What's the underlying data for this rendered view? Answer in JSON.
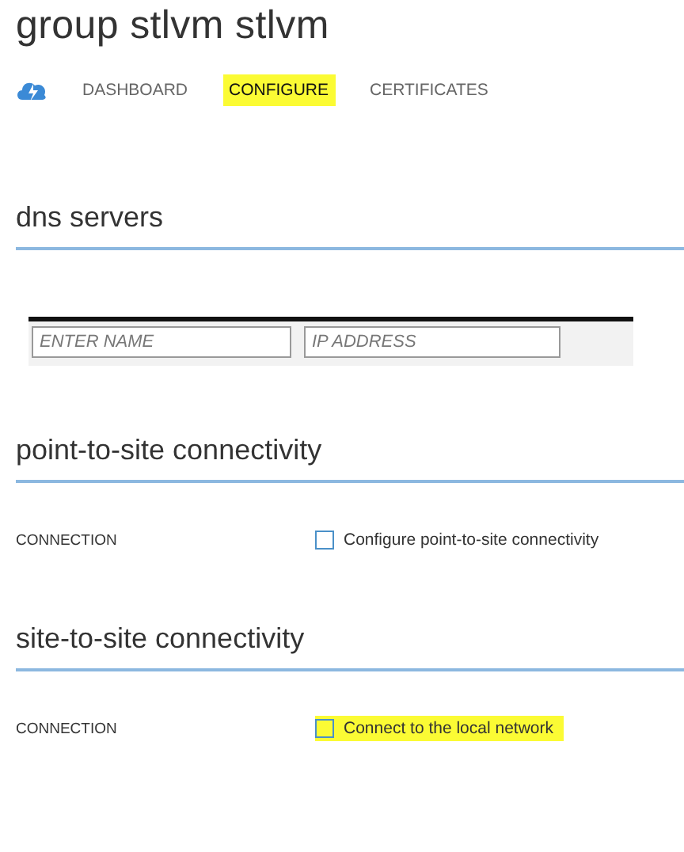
{
  "title": "group stlvm stlvm",
  "tabs": [
    {
      "label": "DASHBOARD",
      "selected": false,
      "highlighted": false
    },
    {
      "label": "CONFIGURE",
      "selected": true,
      "highlighted": true
    },
    {
      "label": "CERTIFICATES",
      "selected": false,
      "highlighted": false
    }
  ],
  "dns_servers": {
    "heading": "dns servers",
    "name_field": {
      "placeholder": "ENTER NAME"
    },
    "ip_field": {
      "placeholder": "IP ADDRESS"
    }
  },
  "sections": [
    {
      "heading": "point-to-site connectivity",
      "label": "CONNECTION",
      "checkbox": {
        "text": "Configure point-to-site connectivity",
        "checked": false,
        "highlighted": false
      }
    },
    {
      "heading": "site-to-site connectivity",
      "label": "CONNECTION",
      "checkbox": {
        "text": "Connect to the local network",
        "checked": false,
        "highlighted": true
      }
    }
  ]
}
